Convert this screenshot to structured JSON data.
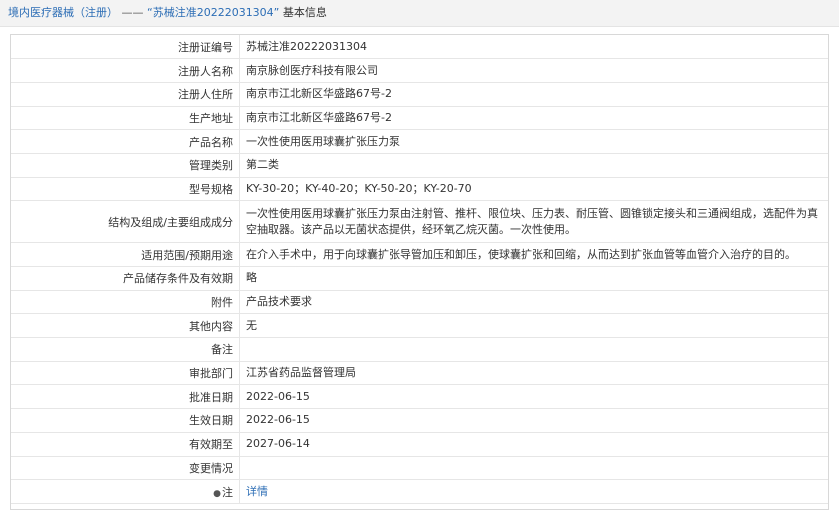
{
  "header": {
    "breadcrumb_link": "境内医疗器械（注册）",
    "separator": "——",
    "title": "“苏械注准20222031304”",
    "suffix": "基本信息"
  },
  "rows": [
    {
      "label": "注册证编号",
      "value": "苏械注准20222031304"
    },
    {
      "label": "注册人名称",
      "value": "南京脉创医疗科技有限公司"
    },
    {
      "label": "注册人住所",
      "value": "南京市江北新区华盛路67号-2"
    },
    {
      "label": "生产地址",
      "value": "南京市江北新区华盛路67号-2"
    },
    {
      "label": "产品名称",
      "value": "一次性使用医用球囊扩张压力泵"
    },
    {
      "label": "管理类别",
      "value": "第二类"
    },
    {
      "label": "型号规格",
      "value": "KY-30-20；KY-40-20；KY-50-20；KY-20-70"
    },
    {
      "label": "结构及组成/主要组成成分",
      "value": "一次性使用医用球囊扩张压力泵由注射管、推杆、限位块、压力表、耐压管、圆锥锁定接头和三通阀组成，选配件为真空抽取器。该产品以无菌状态提供，经环氧乙烷灭菌。一次性使用。"
    },
    {
      "label": "适用范围/预期用途",
      "value": "在介入手术中，用于向球囊扩张导管加压和卸压，使球囊扩张和回缩，从而达到扩张血管等血管介入治疗的目的。"
    },
    {
      "label": "产品储存条件及有效期",
      "value": "略"
    },
    {
      "label": "附件",
      "value": "产品技术要求"
    },
    {
      "label": "其他内容",
      "value": "无"
    },
    {
      "label": "备注",
      "value": ""
    },
    {
      "label": "审批部门",
      "value": "江苏省药品监督管理局"
    },
    {
      "label": "批准日期",
      "value": "2022-06-15"
    },
    {
      "label": "生效日期",
      "value": "2022-06-15"
    },
    {
      "label": "有效期至",
      "value": "2027-06-14"
    },
    {
      "label": "变更情况",
      "value": ""
    }
  ],
  "note_row": {
    "label_icon": "●",
    "label": "注",
    "link_text": "详情"
  }
}
